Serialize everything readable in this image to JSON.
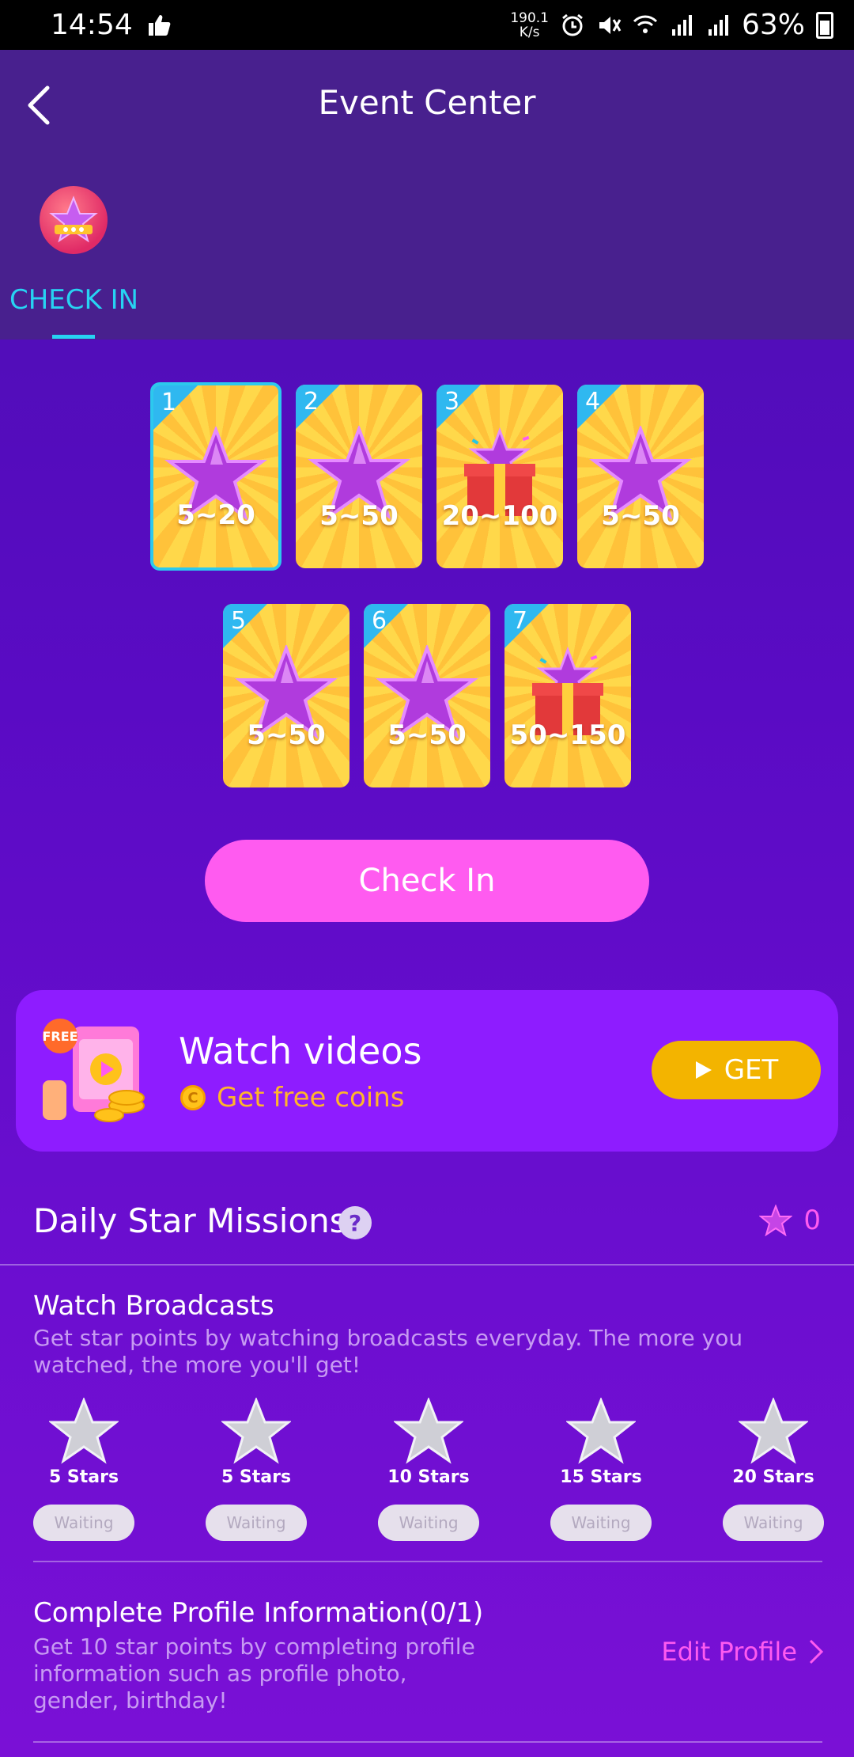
{
  "status_bar": {
    "time": "14:54",
    "speed_top": "190.1",
    "speed_bottom": "K/s",
    "network": "4G",
    "battery": "63%"
  },
  "header": {
    "title": "Event Center",
    "tab_label": "CHECK IN"
  },
  "check_in": {
    "row1": [
      {
        "day": "1",
        "prize": "5~20",
        "kind": "star"
      },
      {
        "day": "2",
        "prize": "5~50",
        "kind": "star"
      },
      {
        "day": "3",
        "prize": "20~100",
        "kind": "gift"
      },
      {
        "day": "4",
        "prize": "5~50",
        "kind": "star"
      }
    ],
    "row2": [
      {
        "day": "5",
        "prize": "5~50",
        "kind": "star"
      },
      {
        "day": "6",
        "prize": "5~50",
        "kind": "star"
      },
      {
        "day": "7",
        "prize": "50~150",
        "kind": "gift"
      }
    ],
    "button_label": "Check In"
  },
  "video_offer": {
    "title": "Watch videos",
    "subtitle": "Get free coins",
    "badge": "FREE",
    "button_label": "GET"
  },
  "missions": {
    "title": "Daily Star Missions",
    "help": "?",
    "star_count": "0",
    "watch_broadcasts": {
      "title": "Watch Broadcasts",
      "description": "Get star points by watching broadcasts everyday. The more you watched, the more you'll get!",
      "tiers": [
        {
          "label": "5 Stars",
          "status": "Waiting"
        },
        {
          "label": "5 Stars",
          "status": "Waiting"
        },
        {
          "label": "10 Stars",
          "status": "Waiting"
        },
        {
          "label": "15 Stars",
          "status": "Waiting"
        },
        {
          "label": "20 Stars",
          "status": "Waiting"
        }
      ]
    },
    "complete_profile": {
      "title": "Complete Profile Information(0/1)",
      "description": "Get 10 star points by completing profile information such as profile photo, gender, birthday!",
      "action_label": "Edit Profile"
    }
  }
}
